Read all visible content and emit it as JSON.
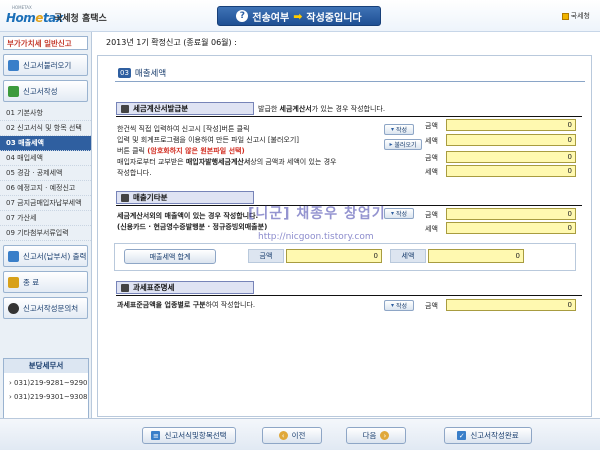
{
  "header": {
    "logo_small": "HOMETAX",
    "logo_main_a": "Hom",
    "logo_main_b": "e",
    "logo_main_c": "tax",
    "brand": "국세청 홈택스",
    "status_q": "?",
    "status_a": "전송여부",
    "status_b": "작성중입니다",
    "nts_label": "국세청"
  },
  "sidebar": {
    "title": "부가가치세 일반신고",
    "load_button": "신고서불러오기",
    "write_button": "신고서작성",
    "items": [
      {
        "label": "01  기본사항"
      },
      {
        "label": "02  신고서식 및 항목 선택"
      },
      {
        "label": "03  매출세액"
      },
      {
        "label": "04  매입세액"
      },
      {
        "label": "05  경감 · 공제세액"
      },
      {
        "label": "06  예정고지 · 예정신고"
      },
      {
        "label": "07  금지금매입자납부세액"
      },
      {
        "label": "07  가산세"
      },
      {
        "label": "09  기타첨부서류입력"
      }
    ],
    "print_button": "신고서(납부서) 출력",
    "exit_button": "종 료",
    "ask_button": "신고서작성문의처",
    "branch_title": "분당세무서",
    "phones": [
      "031)219-9281~9290",
      "031)219-9301~9308"
    ]
  },
  "period_text": "2013년 1기 확정신고 (종료월 06월) :",
  "section_title": {
    "num": "03",
    "label": "매출세액"
  },
  "invoice": {
    "tag": "세금계산서발급분",
    "desc_a": "발급한 ",
    "desc_b": "세금계산서",
    "desc_c": "가 있는 경우 작성합니다.",
    "line1": "한건씩 직접 입력하여 신고시 [작성]버튼 클릭",
    "line2": "입력 및 회계프로그램을 이용하여 만든 파일 신고시 [불러오기]",
    "line3a": "버튼 클릭 ",
    "line3b": "(암호화하지 않은 원본파일 선택)",
    "line4a": "매입자로부터 교부받은 ",
    "line4b": "매입자발행세금계산서",
    "line4c": "상의 금액과 세액이 있는 경우",
    "line5": "작성합니다.",
    "write_btn": "작성",
    "load_btn": "불러오기",
    "amount_label": "금액",
    "tax_label": "세액",
    "values": {
      "amount1": "0",
      "tax1": "0",
      "amount2": "0",
      "tax2": "0"
    }
  },
  "other": {
    "tag": "매출기타분",
    "line1": "세금계산서외의 매출액이 있는 경우 작성합니다.",
    "line2": "(신용카드 · 현금영수증발행분 · 정규증빙외매출분)",
    "write_btn": "작성",
    "amount_label": "금액",
    "tax_label": "세액",
    "values": {
      "amount": "0",
      "tax": "0"
    }
  },
  "totals": {
    "button": "매출세액 합계",
    "amount_label": "금액",
    "amount": "0",
    "tax_label": "세액",
    "tax": "0"
  },
  "standard": {
    "tag": "과세표준명세",
    "desc_a": "과세표준금액을 업종별로 구분",
    "desc_b": "하여 작성합니다.",
    "write_btn": "작성",
    "amount_label": "금액",
    "value": "0"
  },
  "watermark": {
    "title": "[니군] 채종우 창업기",
    "url": "http://nicgoon.tistory.com"
  },
  "footer": {
    "select_btn": "신고서식및항목선택",
    "prev_btn": "이전",
    "next_btn": "다음",
    "done_btn": "신고서작성완료"
  },
  "colors": {
    "accent": "#2f5fa0",
    "field": "#fff9b0",
    "alert": "#d12c20"
  }
}
